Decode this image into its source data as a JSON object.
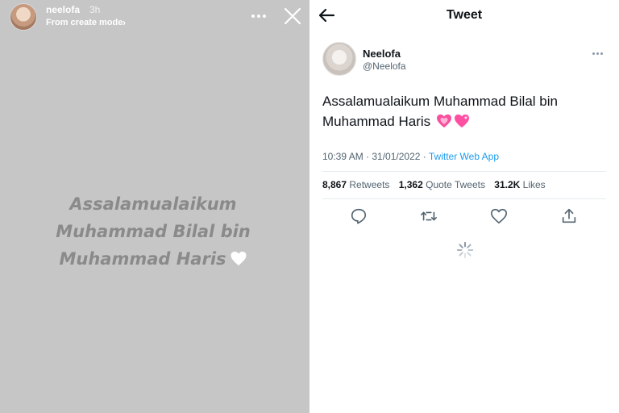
{
  "story": {
    "username": "neelofa",
    "time_ago": "3h",
    "mode_label": "From create mode",
    "text": "Assalamualaikum Muhammad Bilal bin Muhammad Haris",
    "icons": {
      "more": "more-horizontal-icon",
      "close": "close-icon",
      "heart": "white-heart-emoji",
      "chevron": "chevron-right-icon"
    }
  },
  "tweet_view": {
    "title": "Tweet",
    "author": {
      "name": "Neelofa",
      "handle": "@Neelofa"
    },
    "text": "Assalamualaikum Muhammad Bilal bin Muhammad Haris",
    "time": "10:39 AM · 31/01/2022 · ",
    "source": "Twitter Web App",
    "stats": {
      "retweets_count": "8,867",
      "retweets_label": "Retweets",
      "quotes_count": "1,362",
      "quotes_label": "Quote Tweets",
      "likes_count": "31.2K",
      "likes_label": "Likes"
    },
    "icons": [
      "reply-icon",
      "retweet-icon",
      "like-icon",
      "share-icon"
    ],
    "colors": {
      "accent": "#1d9bf0",
      "muted": "#536471",
      "story_bg": "#c6c6c6",
      "story_text": "#8a8a8a"
    }
  }
}
